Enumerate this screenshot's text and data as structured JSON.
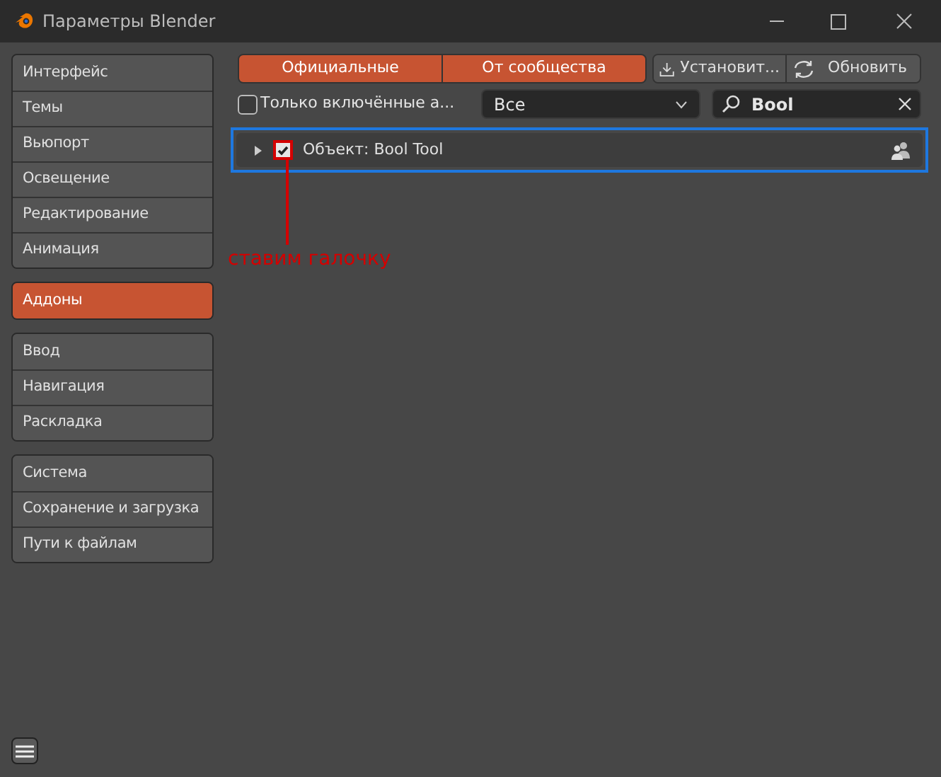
{
  "window": {
    "title": "Параметры Blender"
  },
  "sidebar": {
    "groups": [
      {
        "items": [
          {
            "label": "Интерфейс",
            "selected": false
          },
          {
            "label": "Темы",
            "selected": false
          },
          {
            "label": "Вьюпорт",
            "selected": false
          },
          {
            "label": "Освещение",
            "selected": false
          },
          {
            "label": "Редактирование",
            "selected": false
          },
          {
            "label": "Анимация",
            "selected": false
          }
        ]
      },
      {
        "items": [
          {
            "label": "Аддоны",
            "selected": true
          }
        ]
      },
      {
        "items": [
          {
            "label": "Ввод",
            "selected": false
          },
          {
            "label": "Навигация",
            "selected": false
          },
          {
            "label": "Раскладка",
            "selected": false
          }
        ]
      },
      {
        "items": [
          {
            "label": "Система",
            "selected": false
          },
          {
            "label": "Сохранение и загрузка",
            "selected": false
          },
          {
            "label": "Пути к файлам",
            "selected": false
          }
        ]
      }
    ]
  },
  "source_tabs": [
    {
      "label": "Официальные",
      "selected": true
    },
    {
      "label": "От сообщества",
      "selected": true
    }
  ],
  "actions": [
    {
      "kind": "install",
      "label": "Установит..."
    },
    {
      "kind": "refresh",
      "label": "Обновить"
    }
  ],
  "filter": {
    "enabled_only": {
      "label": "Только включённые а...",
      "checked": false
    },
    "category": {
      "value": "Все"
    },
    "search": {
      "value": "Bool"
    }
  },
  "addons": [
    {
      "label": "Объект: Bool Tool",
      "expanded": false,
      "checked": true,
      "highlighted": true
    }
  ],
  "annotation": {
    "text": "ставим галочку"
  }
}
